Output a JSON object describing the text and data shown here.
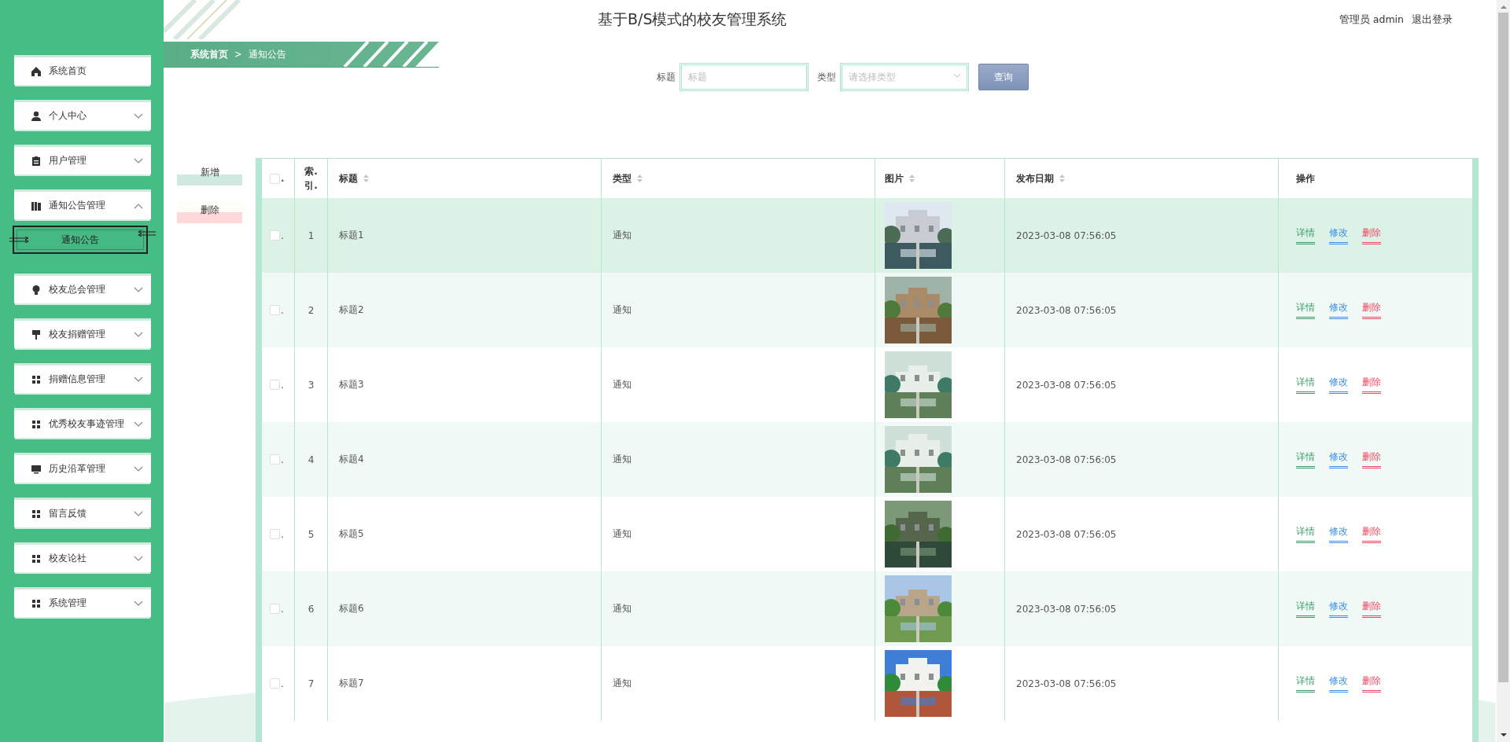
{
  "sidebar": {
    "items": [
      {
        "label": "系统首页"
      },
      {
        "label": "个人中心",
        "expanded": false
      },
      {
        "label": "用户管理",
        "expanded": false
      },
      {
        "label": "通知公告管理",
        "expanded": true,
        "children": [
          {
            "label": "通知公告",
            "selected": true
          }
        ]
      },
      {
        "label": "校友总会管理",
        "expanded": false
      },
      {
        "label": "校友捐赠管理",
        "expanded": false
      },
      {
        "label": "捐赠信息管理",
        "expanded": false
      },
      {
        "label": "优秀校友事迹管理",
        "expanded": false
      },
      {
        "label": "历史沿革管理",
        "expanded": false
      },
      {
        "label": "留言反馈",
        "expanded": false
      },
      {
        "label": "校友论社",
        "expanded": false
      },
      {
        "label": "系统管理",
        "expanded": false
      }
    ]
  },
  "header": {
    "title": "基于B/S模式的校友管理系统",
    "user": "管理员 admin",
    "logout": "退出登录"
  },
  "breadcrumb": {
    "items": [
      "系统首页",
      "通知公告"
    ],
    "separator": ">"
  },
  "search": {
    "fields": [
      {
        "label": "标题",
        "placeholder": "标题",
        "kind": "input"
      },
      {
        "label": "类型",
        "placeholder": "请选择类型",
        "kind": "select"
      }
    ],
    "button": "查询"
  },
  "actions": [
    {
      "label": "新增",
      "kind": "add"
    },
    {
      "label": "删除",
      "kind": "delete"
    }
  ],
  "table": {
    "columns": [
      {
        "label": ".",
        "kind": "check",
        "checked": false
      },
      {
        "label": "索.引.",
        "kind": "index",
        "sortable": false
      },
      {
        "label": "标题",
        "kind": "text",
        "sortable": true
      },
      {
        "label": "类型",
        "kind": "text",
        "sortable": true
      },
      {
        "label": "图片",
        "kind": "picture",
        "sortable": true
      },
      {
        "label": "发布日期",
        "kind": "text",
        "sortable": true
      },
      {
        "label": "操作",
        "kind": "ops",
        "sortable": false
      }
    ],
    "rows": [
      {
        "checked": false,
        "mark": ".",
        "index": "1",
        "title": "标题1",
        "type": "通知",
        "date": "2023-03-08 07:56:05",
        "highlighted": true,
        "actions": [
          {
            "label": "详情",
            "kind": "detail"
          },
          {
            "label": "修改",
            "kind": "edit"
          },
          {
            "label": "删除",
            "kind": "delete"
          }
        ]
      },
      {
        "checked": false,
        "mark": ".",
        "index": "2",
        "title": "标题2",
        "type": "通知",
        "date": "2023-03-08 07:56:05",
        "highlighted": false,
        "actions": [
          {
            "label": "详情",
            "kind": "detail"
          },
          {
            "label": "修改",
            "kind": "edit"
          },
          {
            "label": "删除",
            "kind": "delete"
          }
        ]
      },
      {
        "checked": false,
        "mark": ".",
        "index": "3",
        "title": "标题3",
        "type": "通知",
        "date": "2023-03-08 07:56:05",
        "highlighted": false,
        "actions": [
          {
            "label": "详情",
            "kind": "detail"
          },
          {
            "label": "修改",
            "kind": "edit"
          },
          {
            "label": "删除",
            "kind": "delete"
          }
        ]
      },
      {
        "checked": false,
        "mark": ".",
        "index": "4",
        "title": "标题4",
        "type": "通知",
        "date": "2023-03-08 07:56:05",
        "highlighted": false,
        "actions": [
          {
            "label": "详情",
            "kind": "detail"
          },
          {
            "label": "修改",
            "kind": "edit"
          },
          {
            "label": "删除",
            "kind": "delete"
          }
        ]
      },
      {
        "checked": false,
        "mark": ".",
        "index": "5",
        "title": "标题5",
        "type": "通知",
        "date": "2023-03-08 07:56:05",
        "highlighted": false,
        "actions": [
          {
            "label": "详情",
            "kind": "detail"
          },
          {
            "label": "修改",
            "kind": "edit"
          },
          {
            "label": "删除",
            "kind": "delete"
          }
        ]
      },
      {
        "checked": false,
        "mark": ".",
        "index": "6",
        "title": "标题6",
        "type": "通知",
        "date": "2023-03-08 07:56:05",
        "highlighted": false,
        "actions": [
          {
            "label": "详情",
            "kind": "detail"
          },
          {
            "label": "修改",
            "kind": "edit"
          },
          {
            "label": "删除",
            "kind": "delete"
          }
        ]
      },
      {
        "checked": false,
        "mark": ".",
        "index": "7",
        "title": "标题7",
        "type": "通知",
        "date": "2023-03-08 07:56:05",
        "highlighted": false,
        "actions": [
          {
            "label": "详情",
            "kind": "detail"
          },
          {
            "label": "修改",
            "kind": "edit"
          },
          {
            "label": "删除",
            "kind": "delete"
          }
        ]
      }
    ]
  }
}
